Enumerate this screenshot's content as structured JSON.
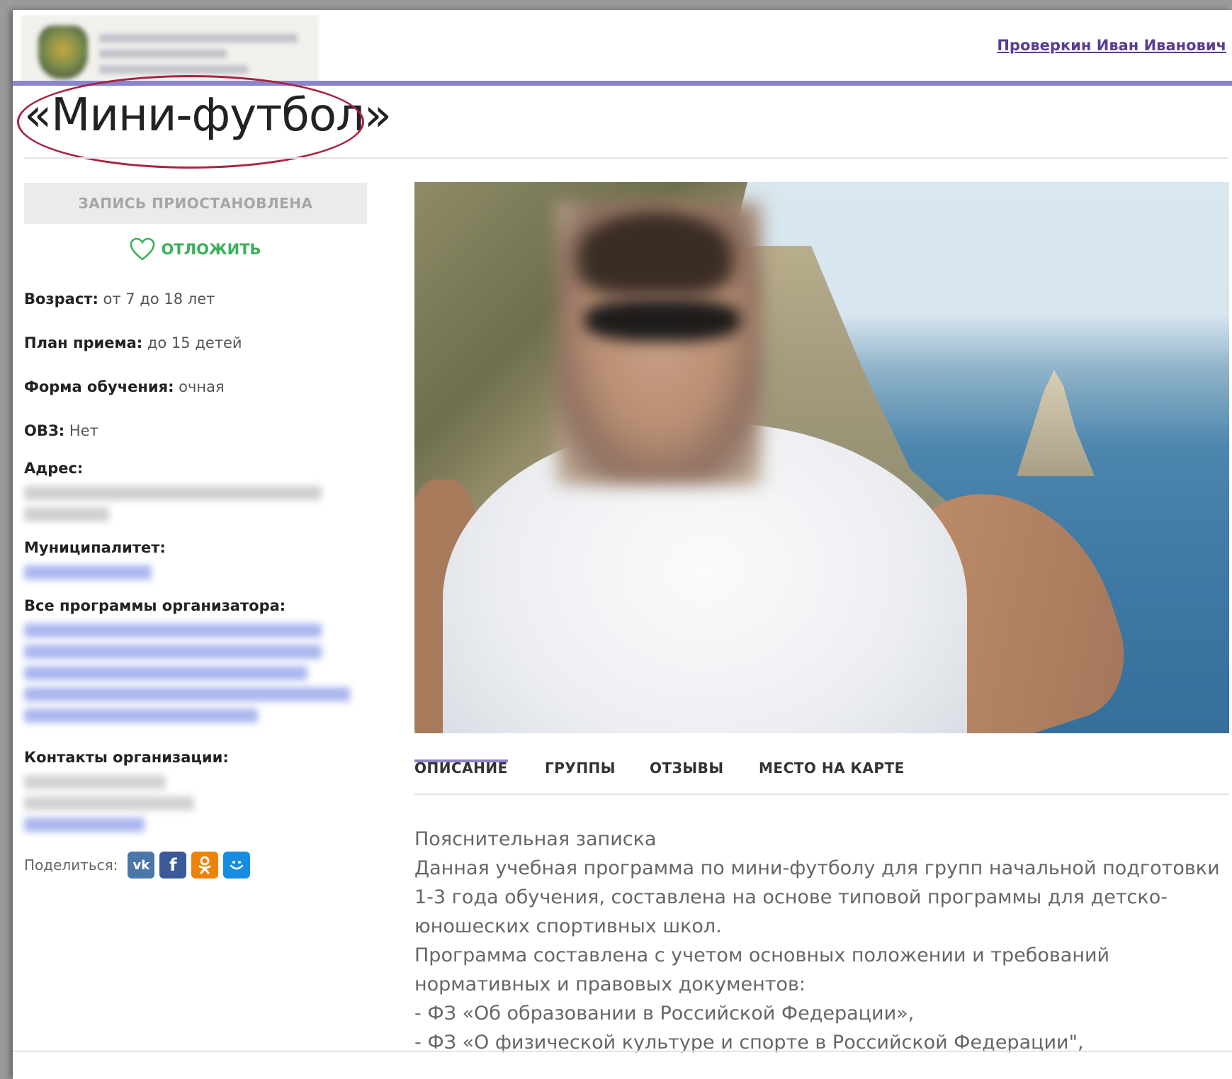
{
  "header": {
    "user_name": "Проверкин Иван Иванович"
  },
  "page": {
    "title": "«Мини-футбол»"
  },
  "sidebar": {
    "enroll_label": "ЗАПИСЬ ПРИОСТАНОВЛЕНА",
    "postpone_label": "ОТЛОЖИТЬ",
    "age_key": "Возраст:",
    "age_value": "от 7 до 18 лет",
    "plan_key": "План приема:",
    "plan_value": "до 15 детей",
    "form_key": "Форма обучения:",
    "form_value": "очная",
    "ovz_key": "ОВЗ:",
    "ovz_value": "Нет",
    "address_label": "Адрес:",
    "municipality_label": "Муниципалитет:",
    "programs_label": "Все программы организатора:",
    "contacts_label": "Контакты организации:",
    "share_label": "Поделиться:"
  },
  "tabs": [
    {
      "label": "ОПИСАНИЕ"
    },
    {
      "label": "ГРУППЫ"
    },
    {
      "label": "ОТЗЫВЫ"
    },
    {
      "label": "МЕСТО НА КАРТЕ"
    }
  ],
  "description": {
    "lines": [
      "Пояснительная записка",
      "Данная учебная программа по мини-футболу для групп начальной подготовки",
      "1-3 года обучения, составлена на основе типовой программы для детско-",
      "юношеских спортивных школ.",
      "Программа составлена с учетом основных положении и требований",
      "нормативных и правовых документов:",
      "- ФЗ «Об образовании в Российской Федерации»,",
      "- ФЗ «О физической культуре и спорте в Российской Федерации\","
    ]
  },
  "icons": {
    "heart": "heart-outline-icon",
    "vk": "vk-icon",
    "facebook": "facebook-icon",
    "odnoklassniki": "odnoklassniki-icon",
    "moimir": "moimir-icon"
  },
  "colors": {
    "accent": "#8a85cc",
    "link": "#5a3d91",
    "postpone_green": "#3db05a",
    "annotation_ellipse": "#a72340"
  }
}
